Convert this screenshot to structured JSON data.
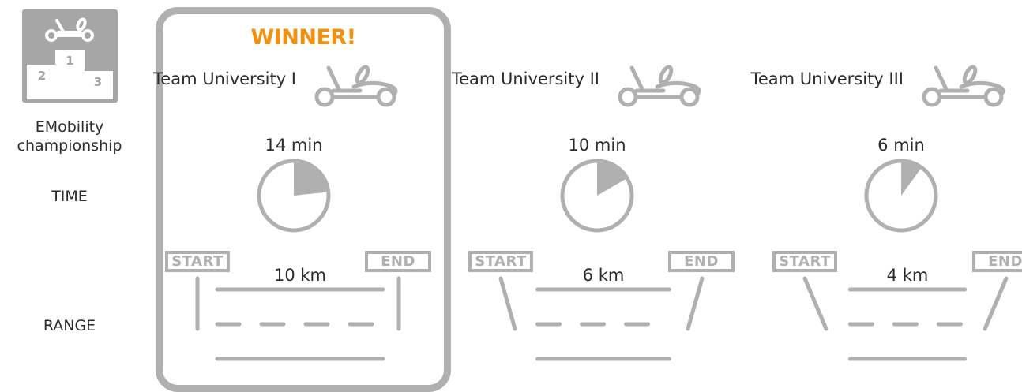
{
  "legend": {
    "title": "EMobility championship",
    "podium_places": [
      "1",
      "2",
      "3"
    ],
    "time_label": "TIME",
    "range_label": "RANGE"
  },
  "winner_label": "WINNER!",
  "flags": {
    "start": "START",
    "end": "END"
  },
  "colors": {
    "winner": "#f2900f",
    "graphic": "#b0b0b0",
    "text": "#2b2b2b"
  },
  "icons": [
    "go-kart-icon",
    "podium-icon",
    "clock-icon",
    "road-icon"
  ],
  "teams": [
    {
      "name": "Team University I",
      "time": "14 min",
      "range": "10 km",
      "time_minutes": 14,
      "range_km": 10,
      "winner": true
    },
    {
      "name": "Team University II",
      "time": "10 min",
      "range": "6 km",
      "time_minutes": 10,
      "range_km": 6,
      "winner": false
    },
    {
      "name": "Team University III",
      "time": "6 min",
      "range": "4 km",
      "time_minutes": 6,
      "range_km": 4,
      "winner": false
    }
  ]
}
